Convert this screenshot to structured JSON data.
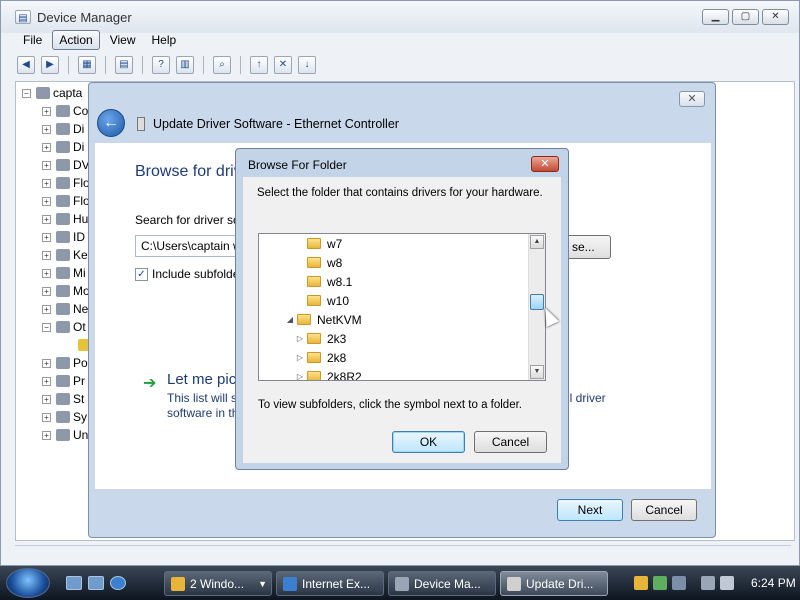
{
  "device_manager": {
    "title": "Device Manager",
    "menu": [
      "File",
      "Action",
      "View",
      "Help"
    ],
    "tree_root": "capta",
    "tree_items": [
      "Co",
      "Di",
      "Di",
      "DV",
      "Flo",
      "Flo",
      "Hu",
      "ID",
      "Ke",
      "Mi",
      "Mo",
      "Ne",
      "Ot",
      "",
      "Po",
      "Pr",
      "St",
      "Sy",
      "Un"
    ]
  },
  "wizard": {
    "title": "Update Driver Software - Ethernet Controller",
    "heading": "Browse for driv",
    "search_label": "Search for driver so",
    "path_value": "C:\\Users\\captain w",
    "browse_label": "se...",
    "include_subfolders_label": "Include subfolde",
    "include_subfolders_checked": true,
    "pick_title": "Let me pic",
    "pick_desc_line1": "This list will s",
    "pick_desc_tail1": "ll driver",
    "pick_desc_line2": "software in th",
    "next_label": "Next",
    "cancel_label": "Cancel"
  },
  "browse_folder": {
    "title": "Browse For Folder",
    "instruction": "Select the folder that contains drivers for your hardware.",
    "folders": [
      {
        "name": "w7",
        "indent": 2,
        "expander": ""
      },
      {
        "name": "w8",
        "indent": 2,
        "expander": ""
      },
      {
        "name": "w8.1",
        "indent": 2,
        "expander": ""
      },
      {
        "name": "w10",
        "indent": 2,
        "expander": ""
      },
      {
        "name": "NetKVM",
        "indent": 1,
        "expander": "◢"
      },
      {
        "name": "2k3",
        "indent": 2,
        "expander": "▷"
      },
      {
        "name": "2k8",
        "indent": 2,
        "expander": "▷"
      },
      {
        "name": "2k8R2",
        "indent": 2,
        "expander": "▷"
      }
    ],
    "hint": "To view subfolders, click the symbol next to a folder.",
    "ok_label": "OK",
    "cancel_label": "Cancel"
  },
  "taskbar": {
    "tasks": [
      {
        "label": "2 Windo...",
        "icon_color": "#e8b53b"
      },
      {
        "label": "Internet Ex...",
        "icon_color": "#3b7fd0"
      },
      {
        "label": "Device Ma...",
        "icon_color": "#9aa6b5"
      },
      {
        "label": "Update Dri...",
        "icon_color": "#d0d0d0"
      }
    ],
    "clock": "6:24 PM"
  }
}
